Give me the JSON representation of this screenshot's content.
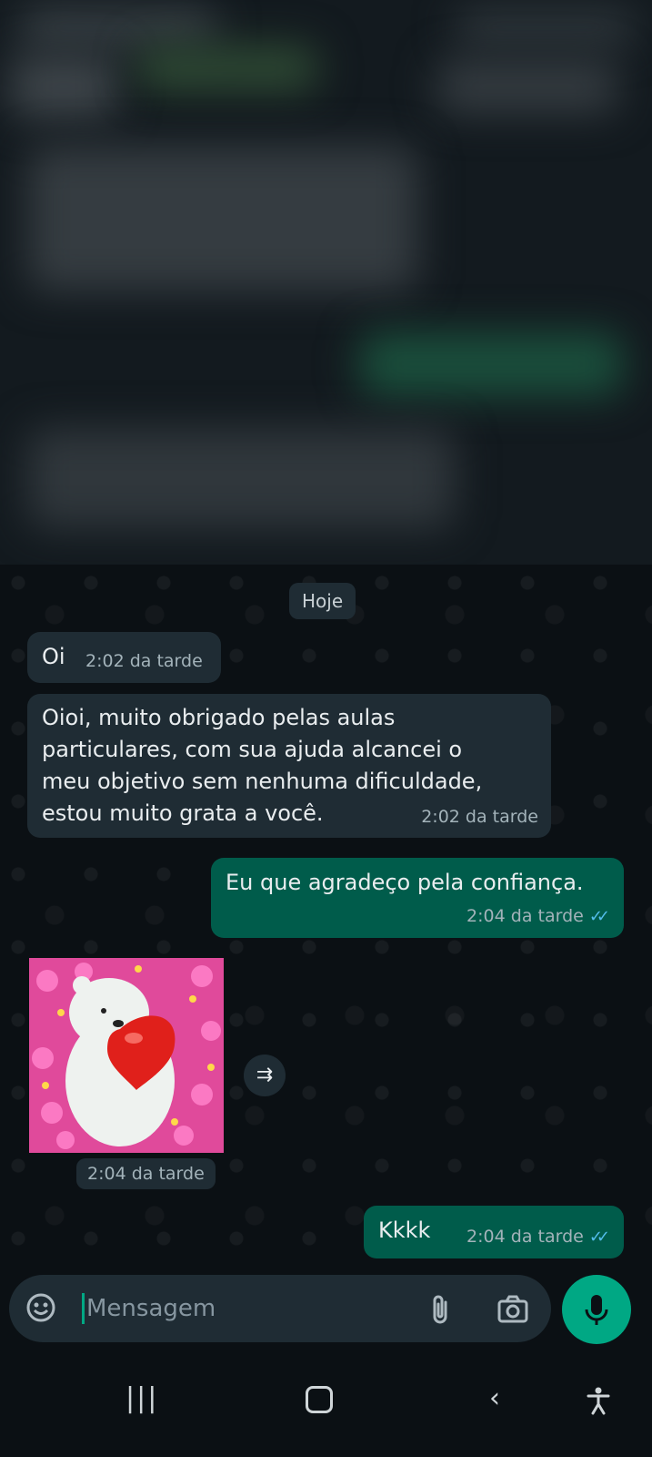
{
  "chat": {
    "date_chip": "Hoje",
    "messages": [
      {
        "direction": "incoming",
        "text": "Oi",
        "time": "2:02 da tarde"
      },
      {
        "direction": "incoming",
        "text": "Oioi, muito obrigado pelas aulas particulares, com sua ajuda alcancei o meu objetivo sem nenhuma dificuldade, estou muito grata a você.",
        "time": "2:02 da tarde"
      },
      {
        "direction": "outgoing",
        "text": "Eu que agradeço pela confiança.",
        "time": "2:04 da tarde",
        "status": "read"
      },
      {
        "direction": "incoming",
        "type": "sticker",
        "sticker": "polar-bear-heart-sticker",
        "time": "2:04 da tarde"
      },
      {
        "direction": "outgoing",
        "text": "Kkkk",
        "time": "2:04 da tarde",
        "status": "read"
      }
    ]
  },
  "input": {
    "placeholder": "Mensagem"
  },
  "icons": {
    "emoji": "emoji-icon",
    "attach": "paperclip-icon",
    "camera": "camera-icon",
    "mic": "microphone-icon",
    "forward": "forward-icon",
    "nav_recents": "recents-icon",
    "nav_home": "home-icon",
    "nav_back": "back-icon",
    "nav_accessibility": "accessibility-icon"
  },
  "colors": {
    "background": "#0b1014",
    "incoming_bubble": "#1f2c34",
    "outgoing_bubble": "#005c4b",
    "accent": "#00a884",
    "read_ticks": "#53bdeb"
  }
}
